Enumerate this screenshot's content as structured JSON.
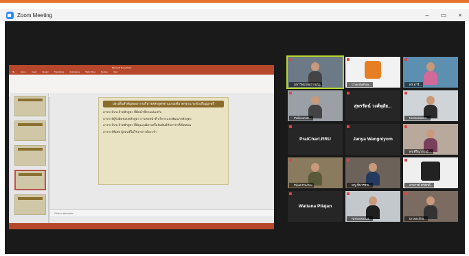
{
  "window": {
    "title": "Zoom Meeting",
    "minimize": "–",
    "maximize": "▭",
    "close": "×"
  },
  "shared_screen": {
    "app_title": "Microsoft PowerPoint",
    "tabs": [
      "File",
      "Home",
      "Insert",
      "Design",
      "Transitions",
      "Animations",
      "Slide Show",
      "Review",
      "View"
    ],
    "slide": {
      "title": "ประเด็นสำคัญของการบริหารหลักสูตรตามเกณฑ์มาตรฐาน ระดับปริญญาตรี",
      "items": [
        "อาจารย์ประจำหลักสูตร ที่มีหน้าที่ตามเล่มปรับ",
        "อาจารย์ผู้รับผิดชอบหลักสูตร การทดหน้าที่ บริหารและพัฒนาหลักสูตร",
        "อาจารย์ประจำหลักสูตร ที่มีคุณวุฒิตรงหรือสัมพันธ์กับสาขาที่เปิดสอน",
        "อาจารย์พิเศษ ผู้สอนที่ไม่ใช่อาจารย์ประจำ"
      ]
    },
    "notes": "Click to add notes"
  },
  "participants": [
    {
      "name": "มหาวิทยาลัยราชภัฏ",
      "kind": "video",
      "active": true
    },
    {
      "name": "ChanthaPaa...",
      "kind": "video",
      "active": false
    },
    {
      "name": "ดร.อารี...",
      "kind": "video",
      "active": false
    },
    {
      "name": "Paiboonrat...",
      "kind": "video",
      "active": false
    },
    {
      "name": "สุพรรัตน์ วงศ์พุลัย...",
      "kind": "name",
      "active": false
    },
    {
      "name": "NisitsukaSat...",
      "kind": "video",
      "active": false
    },
    {
      "name": "PraiChart.RRU",
      "kind": "name",
      "active": false
    },
    {
      "name": "Janya Wangniyom",
      "kind": "name",
      "active": false
    },
    {
      "name": "ดร.ศิริญาภรณ์ ...",
      "kind": "video",
      "active": false
    },
    {
      "name": "Pipat Prachai",
      "kind": "video",
      "active": false
    },
    {
      "name": "หญ.ทิพวรรณ...",
      "kind": "video",
      "active": false
    },
    {
      "name": "อาจารย์ ทวีศักดิ์...",
      "kind": "video",
      "active": false
    },
    {
      "name": "Wattana Pilajan",
      "kind": "name",
      "active": false
    },
    {
      "name": "NisitsukaSat...",
      "kind": "video",
      "active": false
    },
    {
      "name": "Dr.wachira...",
      "kind": "video",
      "active": false
    }
  ]
}
